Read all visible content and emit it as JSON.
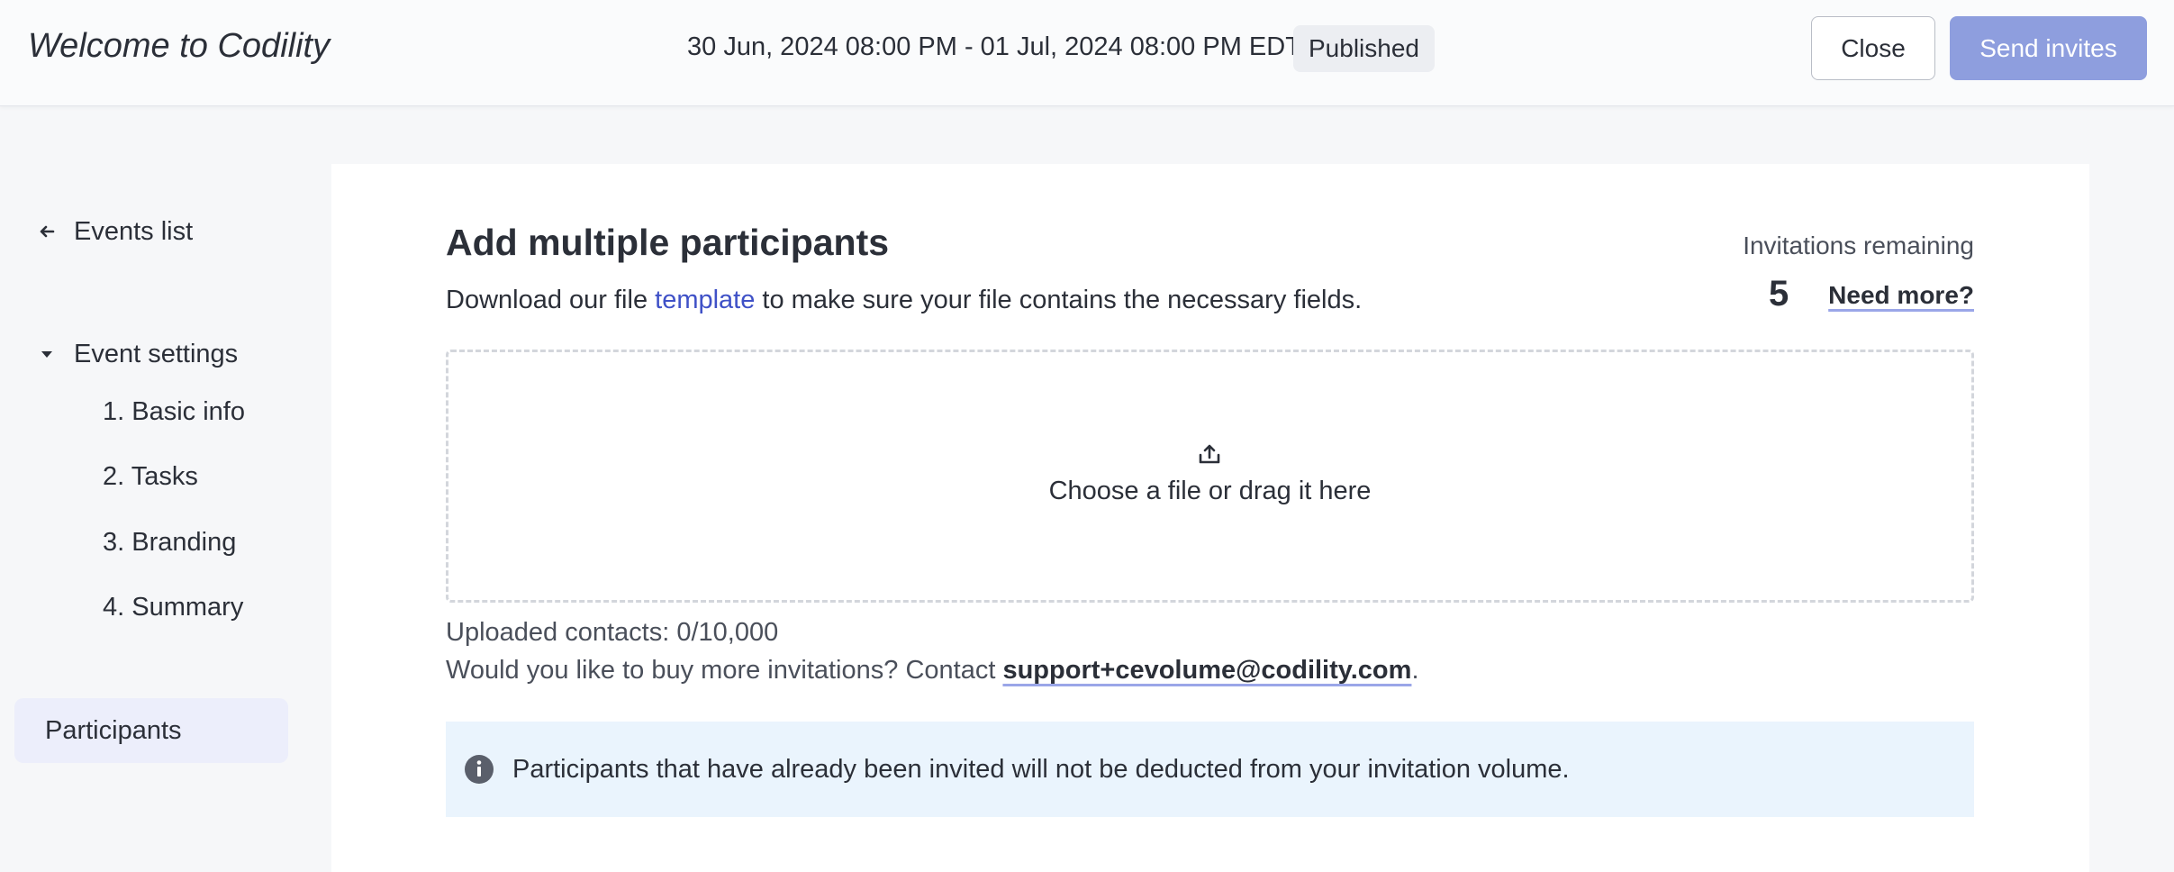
{
  "header": {
    "app_title": "Welcome to Codility",
    "event_range": "30 Jun, 2024 08:00 PM - 01 Jul, 2024 08:00 PM EDT",
    "status": "Published",
    "close_label": "Close",
    "send_label": "Send invites"
  },
  "sidebar": {
    "back_label": "Events list",
    "group_label": "Event settings",
    "steps": [
      "1. Basic info",
      "2. Tasks",
      "3. Branding",
      "4. Summary"
    ],
    "active_label": "Participants"
  },
  "main": {
    "title": "Add multiple participants",
    "desc_prefix": "Download our file ",
    "desc_link": "template",
    "desc_suffix": " to make sure your file contains the necessary fields.",
    "invitations_label": "Invitations remaining",
    "invitations_count": "5",
    "need_more_label": "Need more?",
    "dropzone_text": "Choose a file or drag it here",
    "uploaded_contacts": "Uploaded contacts: 0/10,000",
    "buy_more_prefix": "Would you like to buy more invitations? Contact ",
    "support_email": "support+cevolume@codility.com",
    "buy_more_suffix": ".",
    "notice_text": "Participants that have already been invited will not be deducted from your invitation volume."
  },
  "icons": {
    "back": "arrow-left-icon",
    "group": "caret-down-icon",
    "upload": "upload-icon",
    "info": "info-icon"
  },
  "colors": {
    "accent": "#3f51c7",
    "send_button": "#8e9ede",
    "active_nav": "#eceefb",
    "notice_bg": "#eaf4fd"
  }
}
